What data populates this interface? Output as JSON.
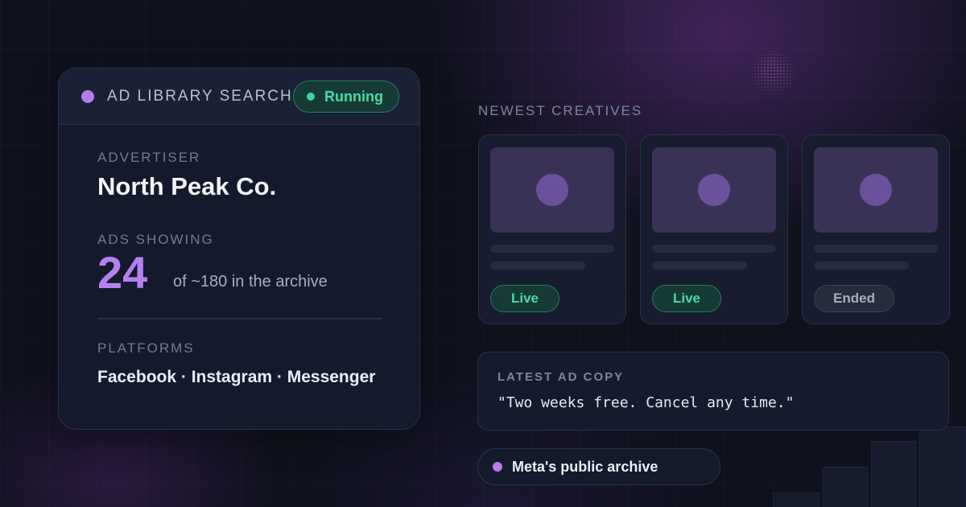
{
  "search_card": {
    "title": "AD LIBRARY SEARCH",
    "status": "Running",
    "advertiser_label": "ADVERTISER",
    "advertiser_name": "North Peak Co.",
    "ads_label": "ADS SHOWING",
    "ads_count": "24",
    "ads_total": "of ~180 in the archive",
    "platforms_label": "PLATFORMS",
    "platforms": "Facebook · Instagram · Messenger"
  },
  "creatives": {
    "label": "NEWEST CREATIVES",
    "items": [
      {
        "status": "Live"
      },
      {
        "status": "Live"
      },
      {
        "status": "Ended"
      }
    ]
  },
  "ad_copy": {
    "label": "LATEST AD COPY",
    "text": "\"Two weeks free. Cancel any time.\""
  },
  "source": {
    "label": "Meta's public archive"
  },
  "colors": {
    "accent_purple": "#b680ee",
    "live_green": "#47dca4",
    "ended_gray": "#a7adc0",
    "background": "#0f111d"
  }
}
